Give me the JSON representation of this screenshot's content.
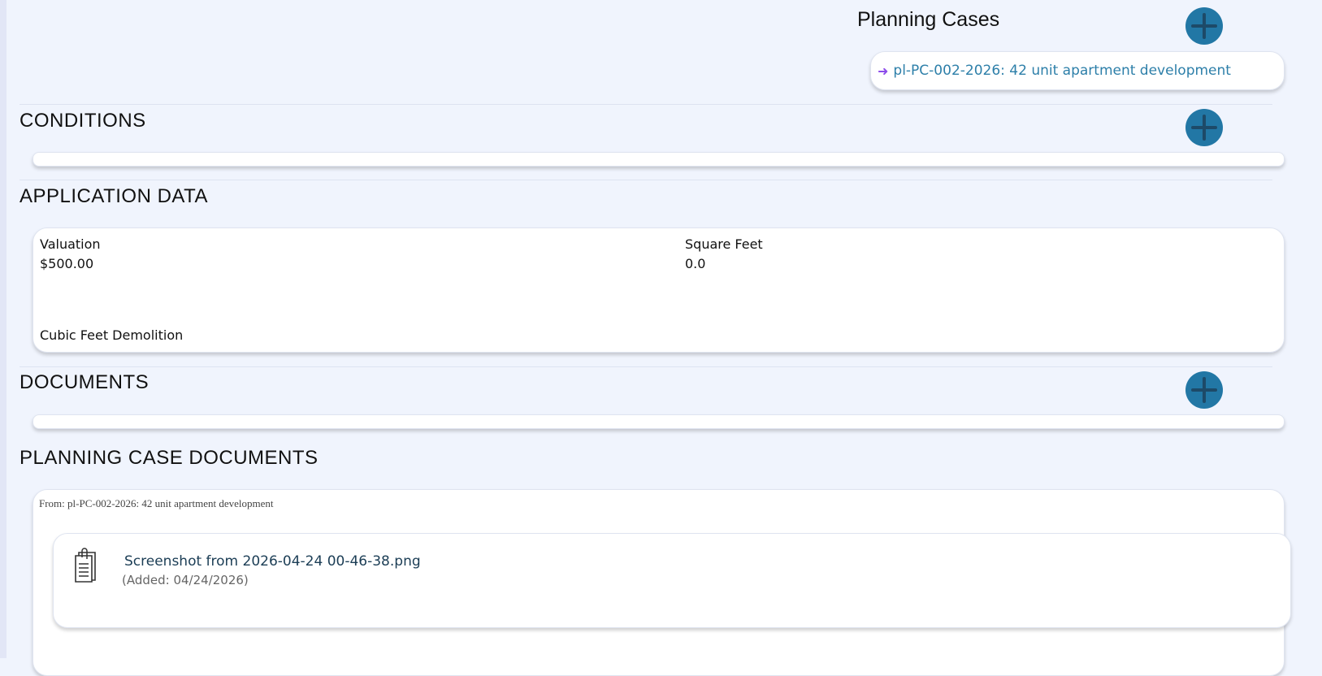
{
  "planning_cases": {
    "title": "Planning Cases",
    "link_text": "pl-PC-002-2026: 42 unit apartment development",
    "add_icon": "plus-icon",
    "arrow_icon": "arrow-right-icon"
  },
  "conditions": {
    "title": "CONDITIONS"
  },
  "application_data": {
    "title": "APPLICATION DATA",
    "valuation_label": "Valuation",
    "valuation_value": "$500.00",
    "square_feet_label": "Square Feet",
    "square_feet_value": "0.0",
    "cubic_feet_label": "Cubic Feet Demolition"
  },
  "documents": {
    "title": "DOCUMENTS"
  },
  "planning_case_documents": {
    "title": "PLANNING CASE DOCUMENTS",
    "from_text": "From: pl-PC-002-2026: 42 unit apartment development",
    "file_name": "Screenshot from 2026-04-24 00-46-38.png",
    "added_text": "(Added: 04/24/2026)",
    "doc_icon": "clipboard-document-icon"
  },
  "colors": {
    "accent": "#2277a5",
    "plus_stroke": "#1d4a68",
    "link": "#2d7fa9",
    "arrow": "#8c4bea",
    "background": "#f0f4fd"
  }
}
